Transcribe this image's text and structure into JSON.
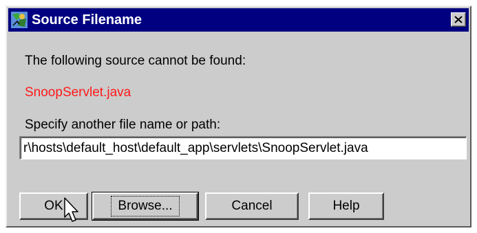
{
  "window": {
    "title": "Source Filename",
    "close_label": "X",
    "icon": "app-icon"
  },
  "message": "The following source cannot be found:",
  "missing_file": "SnoopServlet.java",
  "missing_file_color": "#ff1a1a",
  "path_prompt": "Specify another file name or path:",
  "path_value": "r\\hosts\\default_host\\default_app\\servlets\\SnoopServlet.java",
  "buttons": {
    "ok": "OK",
    "browse": "Browse...",
    "cancel": "Cancel",
    "help": "Help"
  },
  "colors": {
    "titlebar": "#000080",
    "dialog": "#cccccc"
  }
}
